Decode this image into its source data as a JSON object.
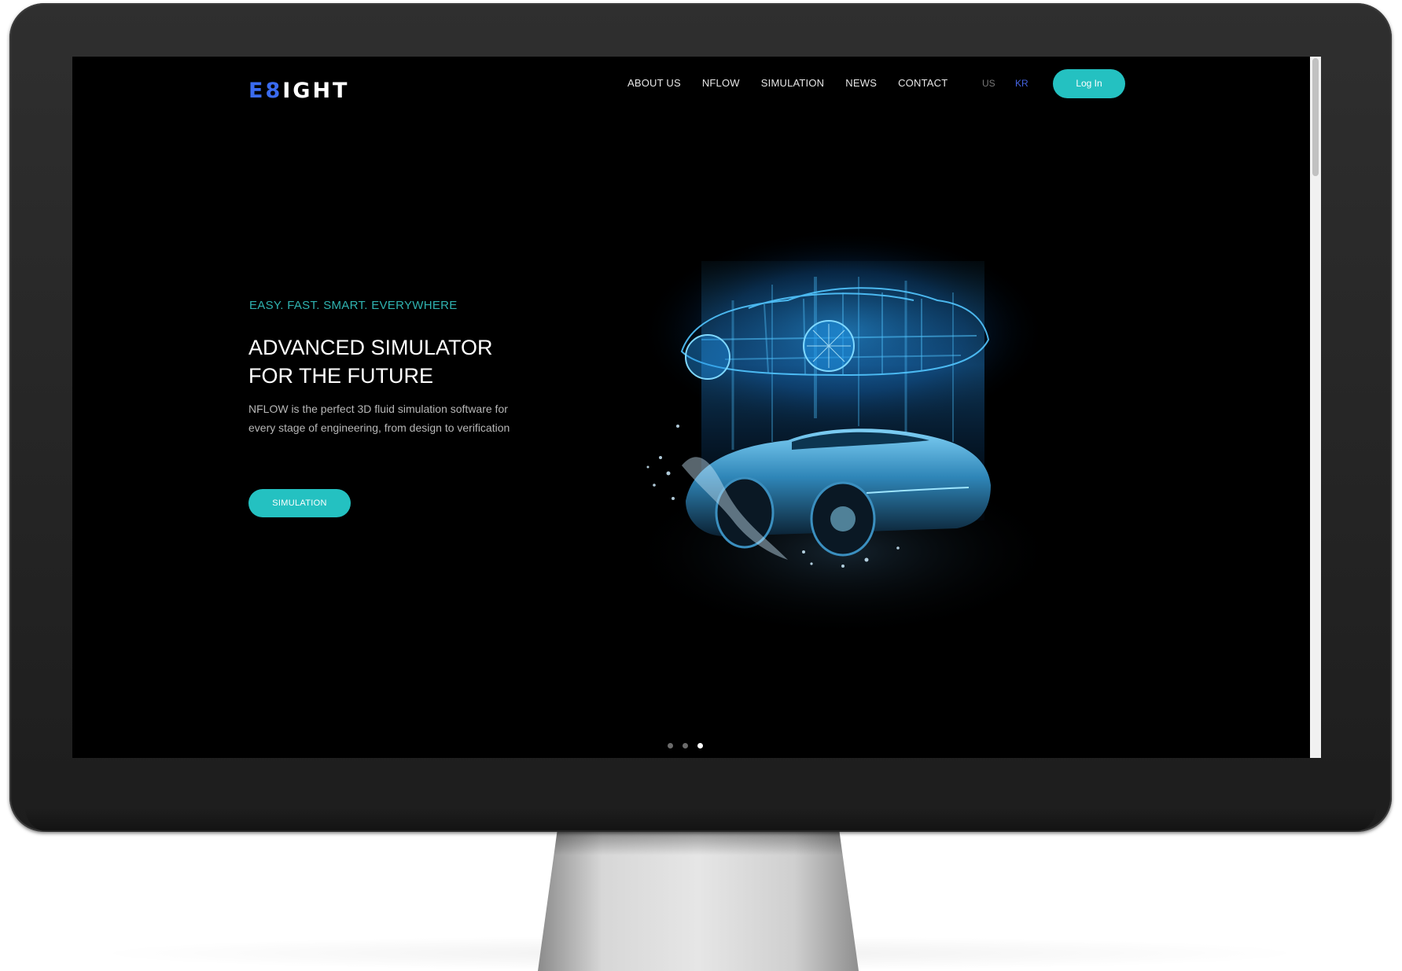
{
  "header": {
    "logo_part1": "E8",
    "logo_part2": "IGHT",
    "nav": [
      "ABOUT US",
      "NFLOW",
      "SIMULATION",
      "NEWS",
      "CONTACT"
    ],
    "lang": {
      "us": "US",
      "kr": "KR"
    },
    "login_label": "Log In"
  },
  "hero": {
    "tagline": "EASY. FAST. SMART. EVERYWHERE",
    "title_line1": "ADVANCED SIMULATOR",
    "title_line2": "FOR THE FUTURE",
    "desc_line1": "NFLOW is the perfect 3D fluid simulation software for",
    "desc_line2": "every stage of engineering, from design to verification",
    "button_label": "SIMULATION",
    "illustration_icon": "car-wireframe-splash-icon"
  },
  "slider": {
    "total": 3,
    "active": 3
  },
  "colors": {
    "accent": "#24c1c1",
    "logo_blue": "#3a6bf0",
    "kr_blue": "#4463e0",
    "background": "#000000",
    "bezel": "#262626"
  }
}
